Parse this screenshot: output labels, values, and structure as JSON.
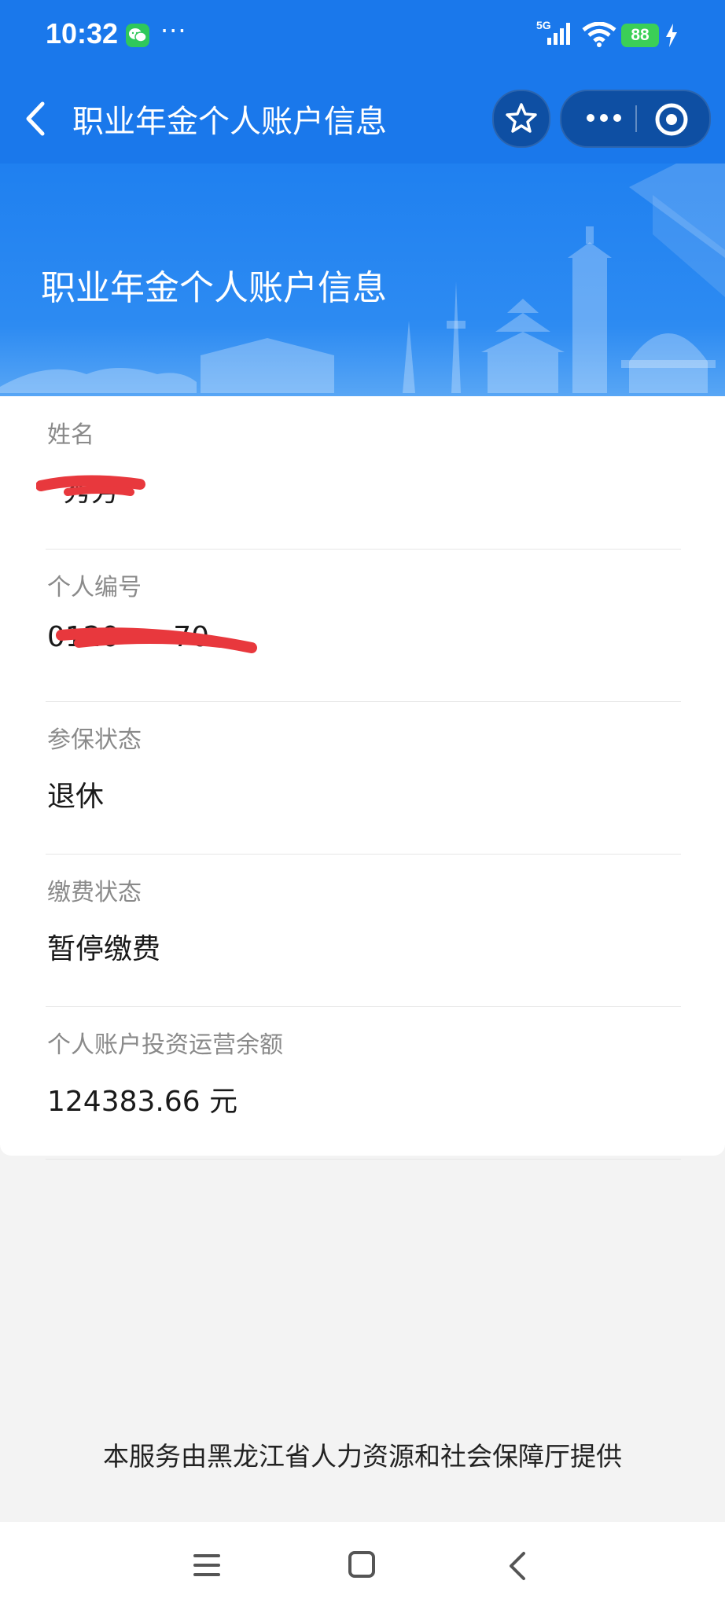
{
  "status_bar": {
    "time": "10:32",
    "dots": "···",
    "network": "5G",
    "battery": "88"
  },
  "nav": {
    "title": "职业年金个人账户信息"
  },
  "banner": {
    "title": "职业年金个人账户信息"
  },
  "fields": [
    {
      "label": "姓名",
      "value": "秀芳"
    },
    {
      "label": "个人编号",
      "value": "0120······70"
    },
    {
      "label": "参保状态",
      "value": "退休"
    },
    {
      "label": "缴费状态",
      "value": "暂停缴费"
    },
    {
      "label": "个人账户投资运营余额",
      "value": "124383.66 元"
    }
  ],
  "footer": {
    "text": "本服务由黑龙江省人力资源和社会保障厅提供"
  },
  "colors": {
    "primary": "#1a78eb",
    "capsule": "#0e4fa3",
    "redact": "#e8383d"
  }
}
